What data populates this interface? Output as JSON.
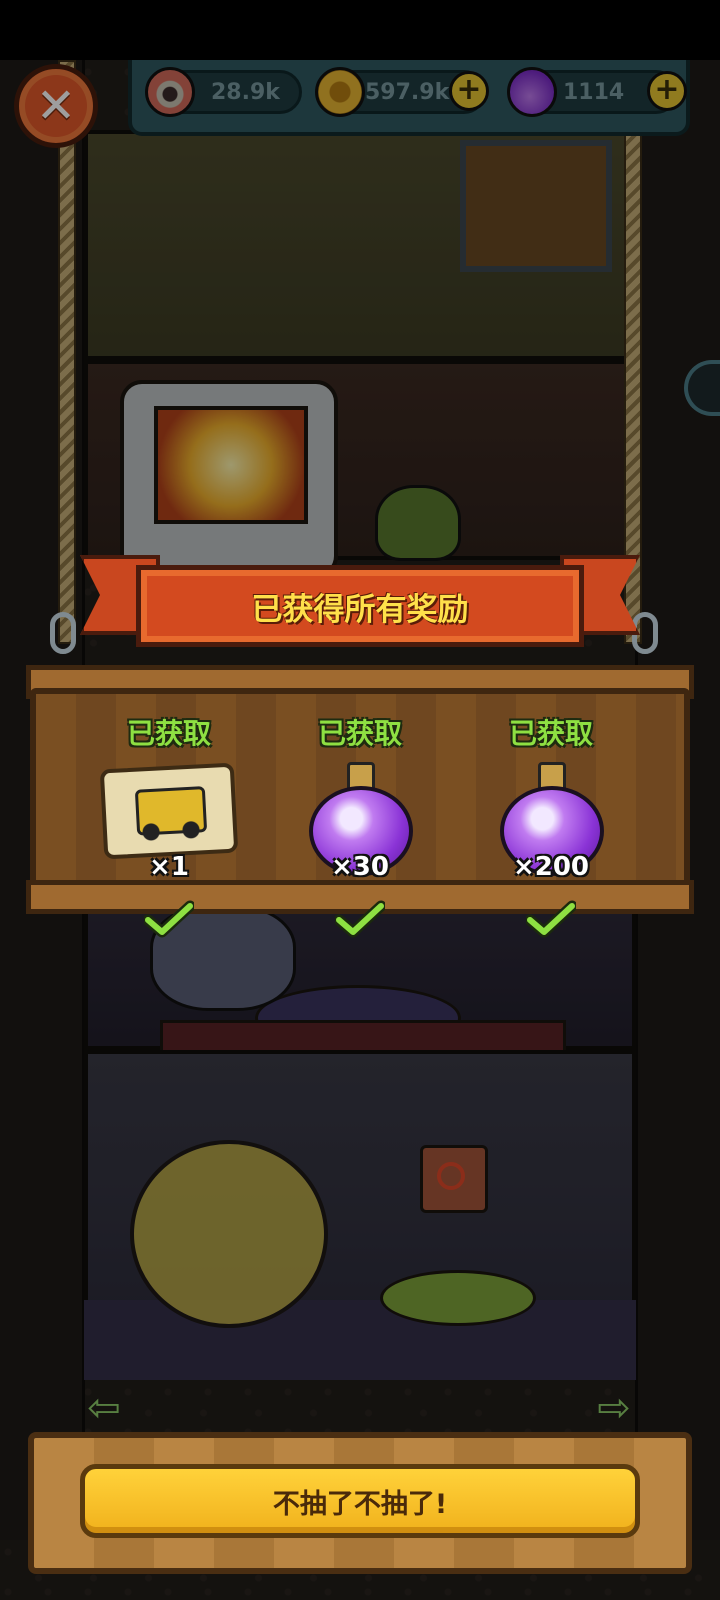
{
  "resources": {
    "eyes": {
      "value": "28.9k",
      "icon": "eyeball-icon"
    },
    "coins": {
      "value": "597.9k",
      "icon": "coin-icon"
    },
    "potions": {
      "value": "1114",
      "icon": "potion-icon"
    }
  },
  "banner": {
    "title": "已获得所有奖励"
  },
  "rewards": [
    {
      "status": "已获取",
      "quantity": "×1",
      "icon": "vehicle-blueprint-icon"
    },
    {
      "status": "已获取",
      "quantity": "×30",
      "icon": "purple-potion-icon"
    },
    {
      "status": "已获取",
      "quantity": "×200",
      "icon": "purple-potion-icon"
    }
  ],
  "action": {
    "button_label": "不抽了不抽了!"
  },
  "colors": {
    "banner": "#d34a1f",
    "banner_text": "#ffe04a",
    "status_green": "#8ee042",
    "button": "#f1b11c",
    "close": "#e2592a"
  }
}
